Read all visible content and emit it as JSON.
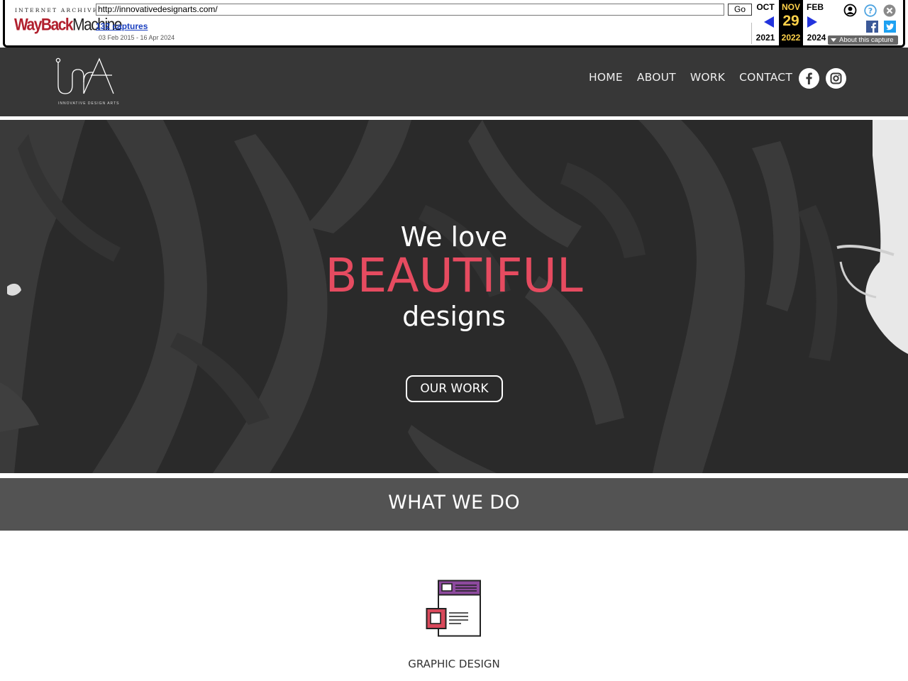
{
  "wayback": {
    "logo_top": "INTERNET ARCHIVE",
    "logo_way": "WayBack",
    "logo_machine": "Machine",
    "url": "http://innovativedesignarts.com/",
    "go_label": "Go",
    "captures": "132 captures",
    "range": "03 Feb 2015 - 16 Apr 2024",
    "prev_month": "OCT",
    "prev_year": "2021",
    "cur_month": "NOV",
    "cur_day": "29",
    "cur_year": "2022",
    "next_month": "FEB",
    "next_year": "2024",
    "about": "About this capture",
    "colors": {
      "highlight": "#ffd24a",
      "arrow": "#2233dd",
      "link": "#1a3fbf"
    }
  },
  "header": {
    "logo_tagline": "INNOVATIVE DESIGN ARTS",
    "nav": [
      "HOME",
      "ABOUT",
      "WORK",
      "CONTACT"
    ],
    "social_icons": [
      "facebook-icon",
      "instagram-icon"
    ]
  },
  "hero": {
    "line1": "We love",
    "line2": "BEAUTIFUL",
    "line3": "designs",
    "button": "OUR WORK",
    "accent_color": "#e64b60"
  },
  "what_we_do": {
    "title": "WHAT WE DO",
    "services": [
      {
        "icon": "graphic-design-icon",
        "title": "GRAPHIC DESIGN"
      }
    ]
  }
}
